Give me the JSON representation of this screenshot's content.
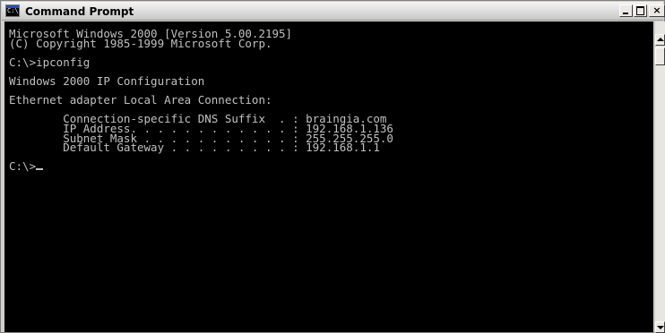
{
  "window": {
    "title": "Command Prompt",
    "icon": "console-icon",
    "icon_text": "C:\\",
    "buttons": {
      "minimize": "minimize",
      "maximize": "maximize",
      "close": "×"
    }
  },
  "console": {
    "background": "#000000",
    "text_color": "#c0c0c0",
    "lines": [
      "Microsoft Windows 2000 [Version 5.00.2195]",
      "(C) Copyright 1985-1999 Microsoft Corp.",
      "",
      "C:\\>ipconfig",
      "",
      "Windows 2000 IP Configuration",
      "",
      "Ethernet adapter Local Area Connection:",
      "",
      "        Connection-specific DNS Suffix  . : braingia.com",
      "        IP Address. . . . . . . . . . . . : 192.168.1.136",
      "        Subnet Mask . . . . . . . . . . . : 255.255.255.0",
      "        Default Gateway . . . . . . . . . : 192.168.1.1",
      ""
    ],
    "prompt": "C:\\>"
  }
}
